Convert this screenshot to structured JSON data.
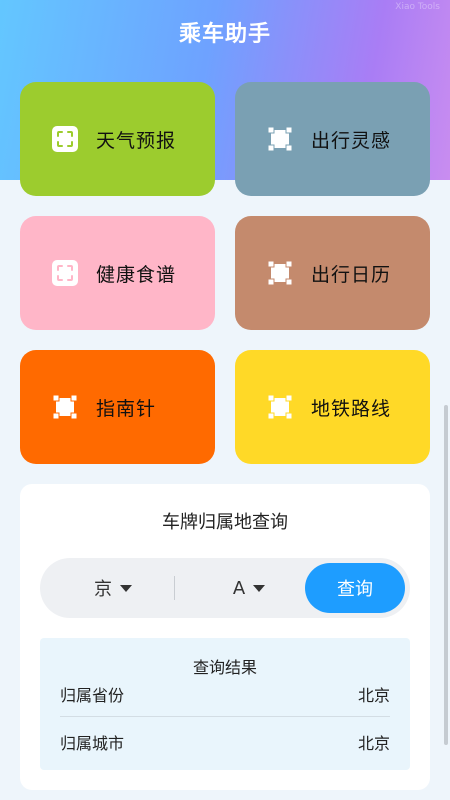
{
  "header": {
    "title": "乘车助手",
    "watermark": "Xiao Tools"
  },
  "tiles": [
    {
      "label": "天气预报",
      "color": "#9ccc2e",
      "icon": "scan-frame-icon"
    },
    {
      "label": "出行灵感",
      "color": "#7aa0b3",
      "icon": "square-handles-icon"
    },
    {
      "label": "健康食谱",
      "color": "#ffb6c8",
      "icon": "scan-frame-icon"
    },
    {
      "label": "出行日历",
      "color": "#c48a6d",
      "icon": "square-handles-icon"
    },
    {
      "label": "指南针",
      "color": "#ff6a00",
      "icon": "square-handles-icon"
    },
    {
      "label": "地铁路线",
      "color": "#ffd927",
      "icon": "square-handles-icon"
    }
  ],
  "plate_query": {
    "title": "车牌归属地查询",
    "province": "京",
    "letter": "A",
    "button_label": "查询",
    "button_color": "#1e9dff",
    "result": {
      "title": "查询结果",
      "rows": [
        {
          "label": "归属省份",
          "value": "北京"
        },
        {
          "label": "归属城市",
          "value": "北京"
        }
      ]
    }
  }
}
